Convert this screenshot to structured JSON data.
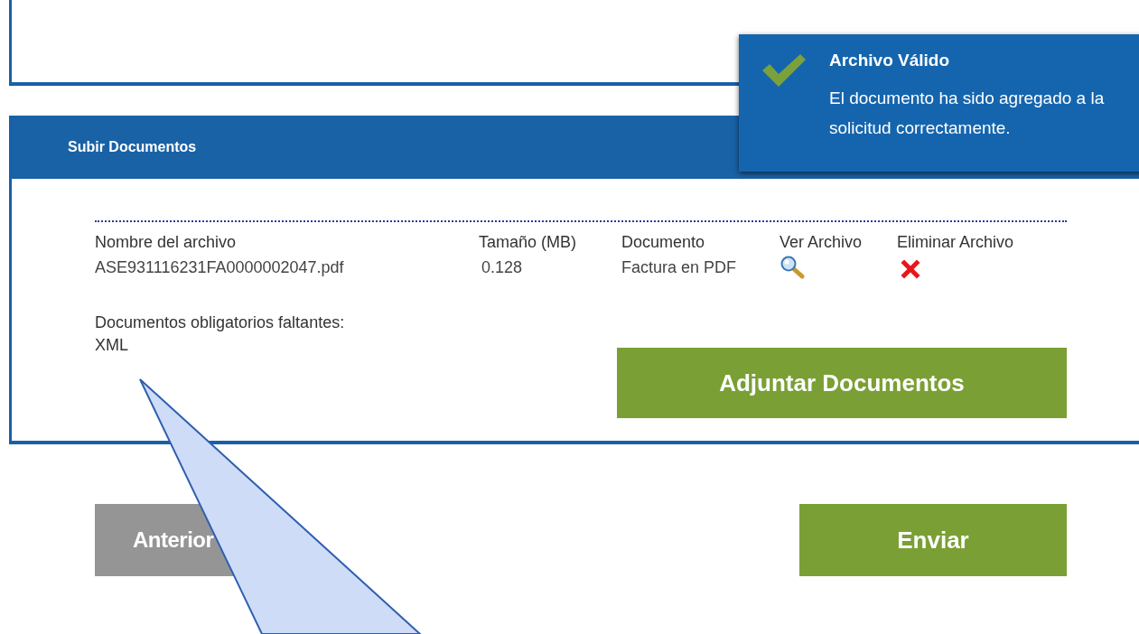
{
  "upload_panel": {
    "title": "Subir Documentos",
    "columns": [
      "Nombre del archivo",
      "Tamaño (MB)",
      "Documento",
      "Ver Archivo",
      "Eliminar Archivo"
    ],
    "files": [
      {
        "name": "ASE931116231FA0000002047.pdf",
        "size": "0.128",
        "document": "Factura en PDF"
      }
    ],
    "missing_label": "Documentos obligatorios faltantes:",
    "missing": [
      "XML"
    ],
    "attach_button": "Adjuntar Documentos"
  },
  "buttons": [
    {
      "label": "Anterior",
      "kind": "secondary"
    },
    {
      "label": "Enviar",
      "kind": "primary"
    }
  ],
  "toast": {
    "title": "Archivo Válido",
    "message": "El documento ha sido agregado a la solicitud correctamente."
  }
}
